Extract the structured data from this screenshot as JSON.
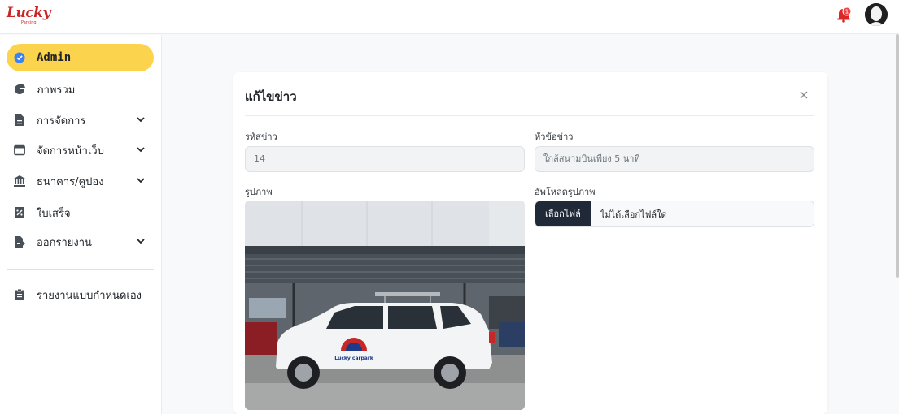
{
  "brand": {
    "logo_text": "Lucky",
    "logo_sub": "Parking"
  },
  "header": {
    "notification_count": "1"
  },
  "sidebar": {
    "items": [
      {
        "label": "Admin",
        "icon": "check-badge-icon",
        "active": true
      },
      {
        "label": "ภาพรวม",
        "icon": "pie-chart-icon"
      },
      {
        "label": "การจัดการ",
        "icon": "document-icon",
        "expandable": true
      },
      {
        "label": "จัดการหน้าเว็บ",
        "icon": "browser-window-icon",
        "expandable": true
      },
      {
        "label": "ธนาคาร/คูปอง",
        "icon": "bank-icon",
        "expandable": true
      },
      {
        "label": "ใบเสร็จ",
        "icon": "receipt-icon"
      },
      {
        "label": "ออกรายงาน",
        "icon": "file-export-icon",
        "expandable": true
      },
      {
        "label": "รายงานแบบกำหนดเอง",
        "icon": "clipboard-icon"
      }
    ]
  },
  "modal": {
    "title": "แก้ไขข่าว",
    "news_id": {
      "label": "รหัสข่าว",
      "value": "14"
    },
    "headline": {
      "label": "หัวข้อข่าว",
      "value": "ใกล้สนามบินเพียง 5 นาที"
    },
    "image": {
      "label": "รูปภาพ",
      "car_text": "Lucky carpark"
    },
    "upload": {
      "label": "อัพโหลดรูปภาพ",
      "button": "เลือกไฟล์",
      "status": "ไม่ได้เลือกไฟล์ใด"
    }
  },
  "colors": {
    "accent": "#fcd34d",
    "brand": "#c62828",
    "dark_button": "#1f2937",
    "active_icon": "#3b82f6"
  }
}
